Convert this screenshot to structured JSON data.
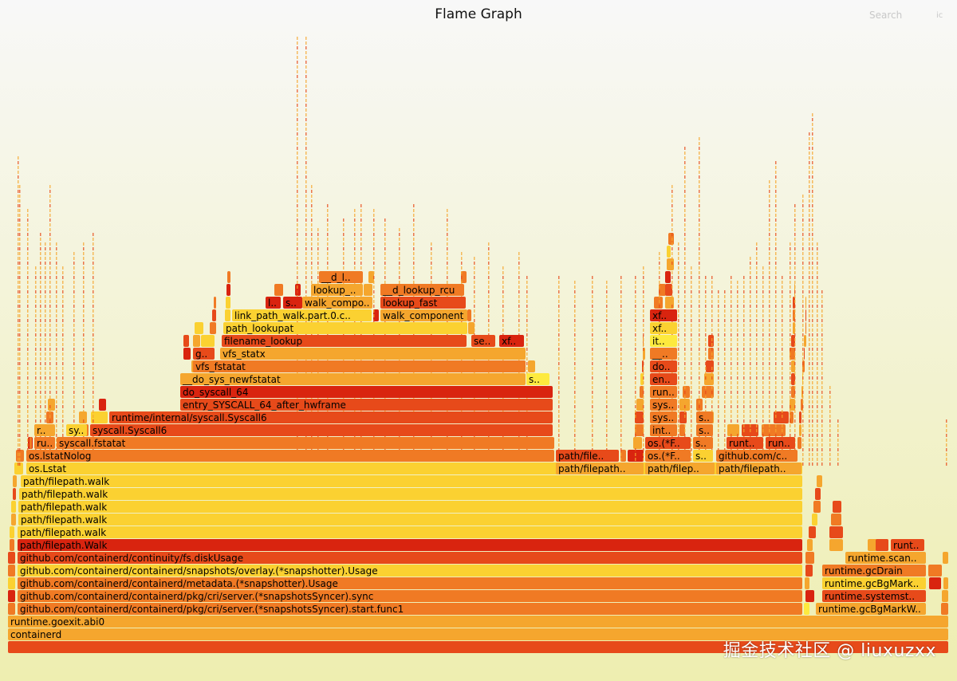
{
  "title": "Flame Graph",
  "search_label": "Search",
  "ic_label": "ic",
  "watermark": "掘金技术社区 @ liuxuzxx",
  "colors": {
    "background_top": "#f8f8f8",
    "background_bottom": "#eeeeb0",
    "frame_palette": [
      "#e74a1a",
      "#f07a24",
      "#f5a62e",
      "#fbd131",
      "#fdea3e",
      "#d9240f"
    ]
  },
  "chart_data": {
    "type": "flamegraph",
    "frames": [
      {
        "label": "",
        "depth": 0
      },
      {
        "label": "containerd",
        "depth": 1
      },
      {
        "label": "runtime.goexit.abi0",
        "depth": 2
      },
      {
        "label": "github.com/containerd/containerd/pkg/cri/server.(*snapshotsSyncer).start.func1",
        "depth": 3
      },
      {
        "label": "runtime.gcBgMarkW..",
        "depth": 3
      },
      {
        "label": "github.com/containerd/containerd/pkg/cri/server.(*snapshotsSyncer).sync",
        "depth": 4
      },
      {
        "label": "runtime.systemst..",
        "depth": 4
      },
      {
        "label": "github.com/containerd/containerd/metadata.(*snapshotter).Usage",
        "depth": 5
      },
      {
        "label": "runtime.gcBgMark..",
        "depth": 5
      },
      {
        "label": "github.com/containerd/containerd/snapshots/overlay.(*snapshotter).Usage",
        "depth": 6
      },
      {
        "label": "runtime.gcDrain",
        "depth": 6
      },
      {
        "label": "github.com/containerd/continuity/fs.diskUsage",
        "depth": 7
      },
      {
        "label": "runtime.scan..",
        "depth": 7
      },
      {
        "label": "path/filepath.Walk",
        "depth": 8
      },
      {
        "label": "runt..",
        "depth": 8
      },
      {
        "label": "path/filepath.walk",
        "depth": 9
      },
      {
        "label": "path/filepath.walk",
        "depth": 10
      },
      {
        "label": "path/filepath.walk",
        "depth": 11
      },
      {
        "label": "path/filepath.walk",
        "depth": 12
      },
      {
        "label": "path/filepath.walk",
        "depth": 13
      },
      {
        "label": "os.Lstat",
        "depth": 14
      },
      {
        "label": "path/filepath..",
        "depth": 14
      },
      {
        "label": "path/filep..",
        "depth": 14
      },
      {
        "label": "path/filepath..",
        "depth": 14
      },
      {
        "label": "os.lstatNolog",
        "depth": 15
      },
      {
        "label": "path/file..",
        "depth": 15
      },
      {
        "label": "os.(*F..",
        "depth": 15
      },
      {
        "label": "s..",
        "depth": 15
      },
      {
        "label": "github.com/c..",
        "depth": 15
      },
      {
        "label": "ru..",
        "depth": 16
      },
      {
        "label": "syscall.fstatat",
        "depth": 16
      },
      {
        "label": "os.(*F..",
        "depth": 16
      },
      {
        "label": "s..",
        "depth": 16
      },
      {
        "label": "runt..",
        "depth": 16
      },
      {
        "label": "run..",
        "depth": 16
      },
      {
        "label": "r..",
        "depth": 17
      },
      {
        "label": "sy..",
        "depth": 17
      },
      {
        "label": "syscall.Syscall6",
        "depth": 17
      },
      {
        "label": "int..",
        "depth": 17
      },
      {
        "label": "s..",
        "depth": 17
      },
      {
        "label": "runtime/internal/syscall.Syscall6",
        "depth": 18
      },
      {
        "label": "sys..",
        "depth": 18
      },
      {
        "label": "s..",
        "depth": 18
      },
      {
        "label": "entry_SYSCALL_64_after_hwframe",
        "depth": 19
      },
      {
        "label": "sys..",
        "depth": 19
      },
      {
        "label": "do_syscall_64",
        "depth": 20
      },
      {
        "label": "run..",
        "depth": 20
      },
      {
        "label": "__do_sys_newfstatat",
        "depth": 21
      },
      {
        "label": "s..",
        "depth": 21
      },
      {
        "label": "en..",
        "depth": 21
      },
      {
        "label": "vfs_fstatat",
        "depth": 22
      },
      {
        "label": "do..",
        "depth": 22
      },
      {
        "label": "g..",
        "depth": 23
      },
      {
        "label": "vfs_statx",
        "depth": 23
      },
      {
        "label": "__..",
        "depth": 23
      },
      {
        "label": "filename_lookup",
        "depth": 24
      },
      {
        "label": "se..",
        "depth": 24
      },
      {
        "label": "xf..",
        "depth": 24
      },
      {
        "label": "it..",
        "depth": 24
      },
      {
        "label": "path_lookupat",
        "depth": 25
      },
      {
        "label": "xf..",
        "depth": 25
      },
      {
        "label": "link_path_walk.part.0.c..",
        "depth": 26
      },
      {
        "label": "walk_component",
        "depth": 26
      },
      {
        "label": "xf..",
        "depth": 26
      },
      {
        "label": "l..",
        "depth": 27
      },
      {
        "label": "s..",
        "depth": 27
      },
      {
        "label": "walk_compo..",
        "depth": 27
      },
      {
        "label": "lookup_fast",
        "depth": 27
      },
      {
        "label": "lookup_..",
        "depth": 28
      },
      {
        "label": "__d_lookup_rcu",
        "depth": 28
      },
      {
        "label": "__d_l..",
        "depth": 29
      }
    ]
  }
}
